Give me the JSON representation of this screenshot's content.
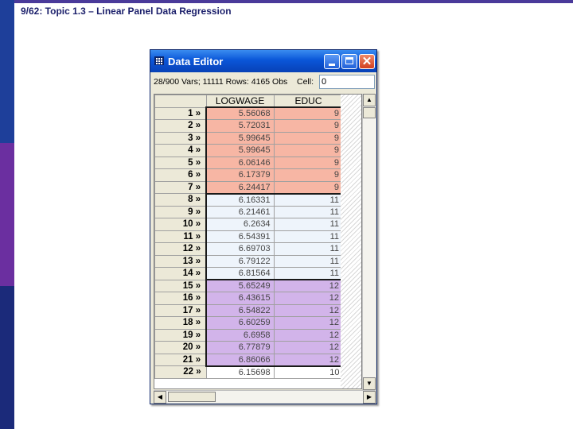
{
  "slide": {
    "title": "9/62: Topic 1.3 – Linear Panel Data Regression"
  },
  "window": {
    "title": "Data Editor",
    "close_glyph": "✕"
  },
  "infobar": {
    "text": "28/900 Vars; 11111 Rows: 4165 Obs",
    "cell_label": "Cell:",
    "cell_value": "0"
  },
  "grid": {
    "columns": [
      "LOGWAGE",
      "EDUC"
    ],
    "rows": [
      {
        "label": "1 »",
        "logwage": "5.56068",
        "educ": "9",
        "group": "red"
      },
      {
        "label": "2 »",
        "logwage": "5.72031",
        "educ": "9",
        "group": "red"
      },
      {
        "label": "3 »",
        "logwage": "5.99645",
        "educ": "9",
        "group": "red"
      },
      {
        "label": "4 »",
        "logwage": "5.99645",
        "educ": "9",
        "group": "red"
      },
      {
        "label": "5 »",
        "logwage": "6.06146",
        "educ": "9",
        "group": "red"
      },
      {
        "label": "6 »",
        "logwage": "6.17379",
        "educ": "9",
        "group": "red"
      },
      {
        "label": "7 »",
        "logwage": "6.24417",
        "educ": "9",
        "group": "red"
      },
      {
        "label": "8 »",
        "logwage": "6.16331",
        "educ": "11",
        "group": "blue"
      },
      {
        "label": "9 »",
        "logwage": "6.21461",
        "educ": "11",
        "group": "blue"
      },
      {
        "label": "10 »",
        "logwage": "6.2634",
        "educ": "11",
        "group": "blue"
      },
      {
        "label": "11 »",
        "logwage": "6.54391",
        "educ": "11",
        "group": "blue"
      },
      {
        "label": "12 »",
        "logwage": "6.69703",
        "educ": "11",
        "group": "blue"
      },
      {
        "label": "13 »",
        "logwage": "6.79122",
        "educ": "11",
        "group": "blue"
      },
      {
        "label": "14 »",
        "logwage": "6.81564",
        "educ": "11",
        "group": "blue"
      },
      {
        "label": "15 »",
        "logwage": "5.65249",
        "educ": "12",
        "group": "purple"
      },
      {
        "label": "16 »",
        "logwage": "6.43615",
        "educ": "12",
        "group": "purple"
      },
      {
        "label": "17 »",
        "logwage": "6.54822",
        "educ": "12",
        "group": "purple"
      },
      {
        "label": "18 »",
        "logwage": "6.60259",
        "educ": "12",
        "group": "purple"
      },
      {
        "label": "19 »",
        "logwage": "6.6958",
        "educ": "12",
        "group": "purple"
      },
      {
        "label": "20 »",
        "logwage": "6.77879",
        "educ": "12",
        "group": "purple"
      },
      {
        "label": "21 »",
        "logwage": "6.86066",
        "educ": "12",
        "group": "purple"
      },
      {
        "label": "22 »",
        "logwage": "6.15698",
        "educ": "10",
        "group": "none"
      }
    ]
  },
  "colors": {
    "red": "#f7b6a4",
    "blue": "#eef4fb",
    "purple": "#d2b4ea",
    "none": "#ffffff",
    "block_border": "#1a1a1a"
  },
  "scrollbar": {
    "up_icon": "▲",
    "down_icon": "▼",
    "left_icon": "◀",
    "right_icon": "▶"
  }
}
